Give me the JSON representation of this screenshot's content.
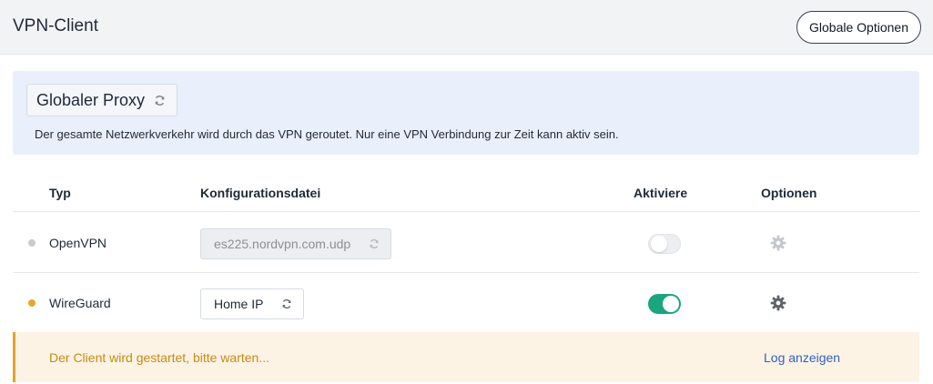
{
  "header": {
    "title": "VPN-Client",
    "global_options_label": "Globale Optionen"
  },
  "proxy": {
    "mode_label": "Globaler Proxy",
    "description": "Der gesamte Netzwerkverkehr wird durch das VPN geroutet. Nur eine VPN Verbindung zur Zeit kann aktiv sein."
  },
  "table": {
    "columns": {
      "type": "Typ",
      "config_file": "Konfigurationsdatei",
      "activate": "Aktiviere",
      "options": "Optionen"
    },
    "rows": [
      {
        "type": "OpenVPN",
        "config_file": "es225.nordvpn.com.udp",
        "status_dot_color": "#c8cbd0",
        "enabled": false,
        "config_disabled": true,
        "icons": {
          "config": "refresh-icon",
          "options": "gear-icon"
        }
      },
      {
        "type": "WireGuard",
        "config_file": "Home IP",
        "status_dot_color": "#e8a52d",
        "enabled": true,
        "config_disabled": false,
        "icons": {
          "config": "refresh-icon",
          "options": "gear-icon"
        }
      }
    ]
  },
  "status": {
    "message": "Der Client wird gestartet, bitte warten...",
    "log_link": "Log anzeigen",
    "color": "#c78a17"
  },
  "colors": {
    "accent_green": "#1aa57f",
    "link_blue": "#2f63c6",
    "warning_orange": "#e3a32a"
  }
}
